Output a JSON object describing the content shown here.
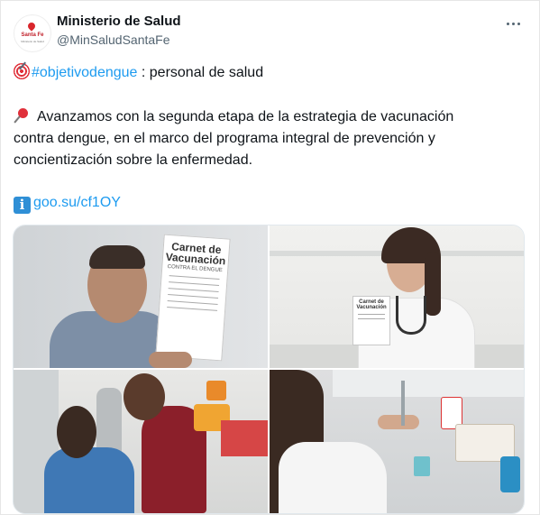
{
  "tweet": {
    "display_name": "Ministerio de Salud",
    "handle": "@MinSaludSantaFe",
    "avatar_text": "Santa Fe",
    "avatar_subtext": "Ministerio de Salud",
    "line1_hashtag": "#objetivodengue",
    "line1_rest": " : personal de salud",
    "body_line1": "Avanzamos con la segunda etapa de la estrategia de vacunación",
    "body_line2": "contra dengue, en el marco del programa integral de prevención y",
    "body_line3": "concientización sobre la enfermedad.",
    "link_text": "goo.su/cf1OY",
    "more_icon": "more-horizontal-icon",
    "emojis": [
      "direct-hit-icon",
      "pushpin-icon",
      "information-icon"
    ]
  },
  "media": {
    "card_title_1": "Carnet de",
    "card_title_2": "Vacunación",
    "card_subtitle": "CONTRA EL DENGUE",
    "small_card_title_1": "Carnet de",
    "small_card_title_2": "Vacunación"
  },
  "colors": {
    "link": "#1d9bf0",
    "text": "#0f1419",
    "muted": "#536471",
    "scrubs": "#8b1f2a",
    "patient_top": "#3f78b5"
  }
}
